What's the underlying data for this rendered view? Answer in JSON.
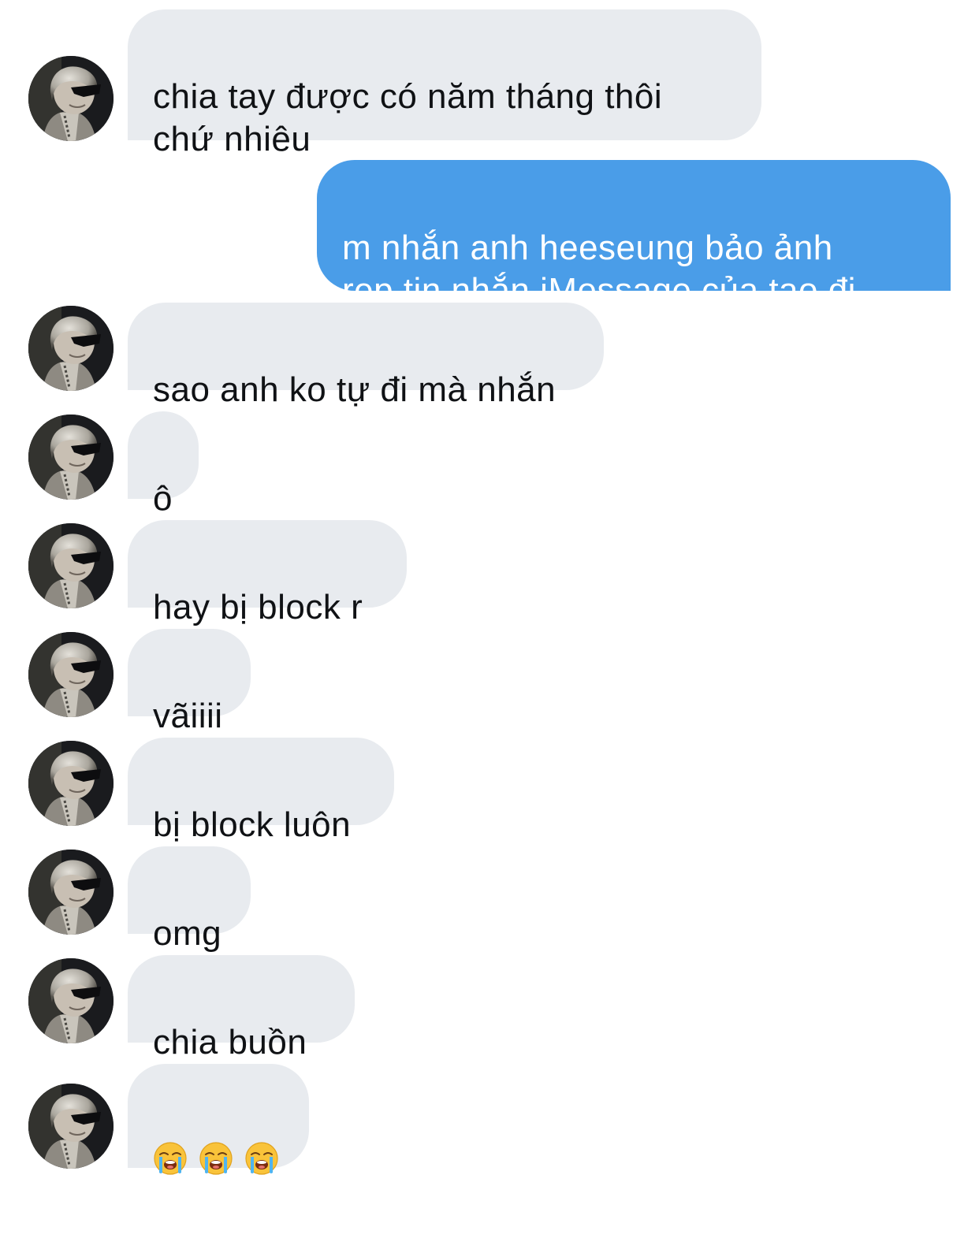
{
  "conversation": {
    "messages": [
      {
        "direction": "incoming",
        "text": "chia tay được có năm tháng thôi\nchứ nhiêu",
        "avatar": "contact-avatar"
      },
      {
        "direction": "outgoing",
        "text": "m nhắn anh heeseung bảo ảnh\nrep tin nhắn iMessage của tao đi"
      },
      {
        "direction": "incoming",
        "text": "sao anh ko tự đi mà nhắn",
        "avatar": "contact-avatar"
      },
      {
        "direction": "incoming",
        "text": "ô",
        "avatar": "contact-avatar"
      },
      {
        "direction": "incoming",
        "text": "hay bị block r",
        "avatar": "contact-avatar"
      },
      {
        "direction": "incoming",
        "text": "vãiiii",
        "avatar": "contact-avatar"
      },
      {
        "direction": "incoming",
        "text": "bị block luôn",
        "avatar": "contact-avatar"
      },
      {
        "direction": "incoming",
        "text": "omg",
        "avatar": "contact-avatar"
      },
      {
        "direction": "incoming",
        "text": "chia buồn",
        "avatar": "contact-avatar"
      },
      {
        "direction": "incoming",
        "text": "",
        "emoji": [
          "loudly-crying-face",
          "loudly-crying-face",
          "loudly-crying-face"
        ],
        "avatar": "contact-avatar"
      }
    ]
  },
  "colors": {
    "incoming_bubble": "#e8ebef",
    "outgoing_bubble": "#4a9de8",
    "incoming_text": "#101215",
    "outgoing_text": "#ffffff"
  }
}
